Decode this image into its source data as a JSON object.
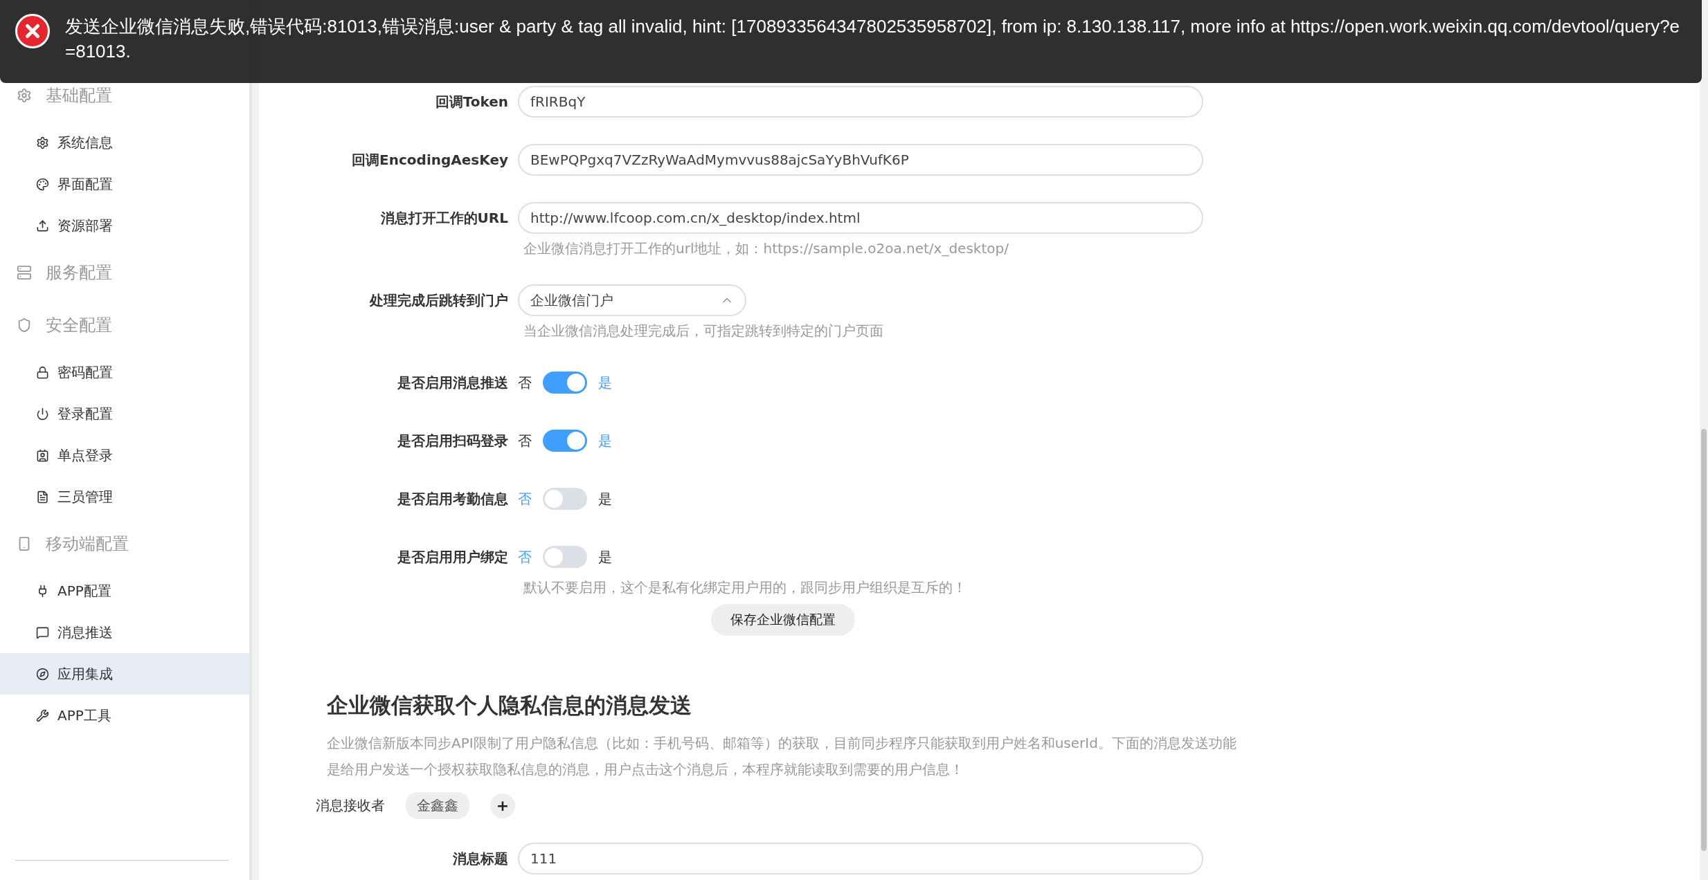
{
  "notification": {
    "kind": "error",
    "message": "发送企业微信消息失败,错误代码:81013,错误消息:user & party & tag all invalid, hint: [1708933564347802535958702], from ip: 8.130.138.117, more info at https://open.work.weixin.qq.com/devtool/query?e=81013."
  },
  "sidebar": {
    "groups": [
      {
        "label": "基础配置",
        "children": [
          {
            "label": "系统信息",
            "selected": false
          },
          {
            "label": "界面配置",
            "selected": false
          },
          {
            "label": "资源部署",
            "selected": false
          }
        ]
      },
      {
        "label": "服务配置"
      },
      {
        "label": "安全配置",
        "children": [
          {
            "label": "密码配置",
            "selected": false
          },
          {
            "label": "登录配置",
            "selected": false
          },
          {
            "label": "单点登录",
            "selected": false
          },
          {
            "label": "三员管理",
            "selected": false
          }
        ]
      },
      {
        "label": "移动端配置",
        "children": [
          {
            "label": "APP配置",
            "selected": false
          },
          {
            "label": "消息推送",
            "selected": false
          },
          {
            "label": "应用集成",
            "selected": true
          },
          {
            "label": "APP工具",
            "selected": false
          }
        ]
      }
    ]
  },
  "form": {
    "fields": [
      {
        "kind": "input",
        "label": "回调Token",
        "value": "fRIRBqY"
      },
      {
        "kind": "input",
        "label": "回调EncodingAesKey",
        "value": "BEwPQPgxq7VZzRyWaAdMymvvus88ajcSaYyBhVufK6P"
      },
      {
        "kind": "input",
        "label": "消息打开工作的URL",
        "value": "http://www.lfcoop.com.cn/x_desktop/index.html",
        "hint": "企业微信消息打开工作的url地址，如：https://sample.o2oa.net/x_desktop/"
      },
      {
        "kind": "select",
        "label": "处理完成后跳转到门户",
        "value": "企业微信门户",
        "expanded": true,
        "hint": "当企业微信消息处理完成后，可指定跳转到特定的门户页面"
      },
      {
        "kind": "toggle",
        "label": "是否启用消息推送",
        "off_label": "否",
        "on_label": "是",
        "on": true
      },
      {
        "kind": "toggle",
        "label": "是否启用扫码登录",
        "off_label": "否",
        "on_label": "是",
        "on": true
      },
      {
        "kind": "toggle",
        "label": "是否启用考勤信息",
        "off_label": "否",
        "on_label": "是",
        "on": false
      },
      {
        "kind": "toggle",
        "label": "是否启用用户绑定",
        "off_label": "否",
        "on_label": "是",
        "on": false,
        "hint": "默认不要启用，这个是私有化绑定用户用的，跟同步用户组织是互斥的！"
      }
    ],
    "save_button": "保存企业微信配置"
  },
  "privacy_section": {
    "title": "企业微信获取个人隐私信息的消息发送",
    "description": "企业微信新版本同步API限制了用户隐私信息（比如：手机号码、邮箱等）的获取，目前同步程序只能获取到用户姓名和userId。下面的消息发送功能是给用户发送一个授权获取隐私信息的消息，用户点击这个消息后，本程序就能读取到需要的用户信息！",
    "receivers_label": "消息接收者",
    "receivers": [
      "金鑫鑫"
    ],
    "add_button": "+",
    "title_field": {
      "label": "消息标题",
      "value": "111"
    }
  }
}
